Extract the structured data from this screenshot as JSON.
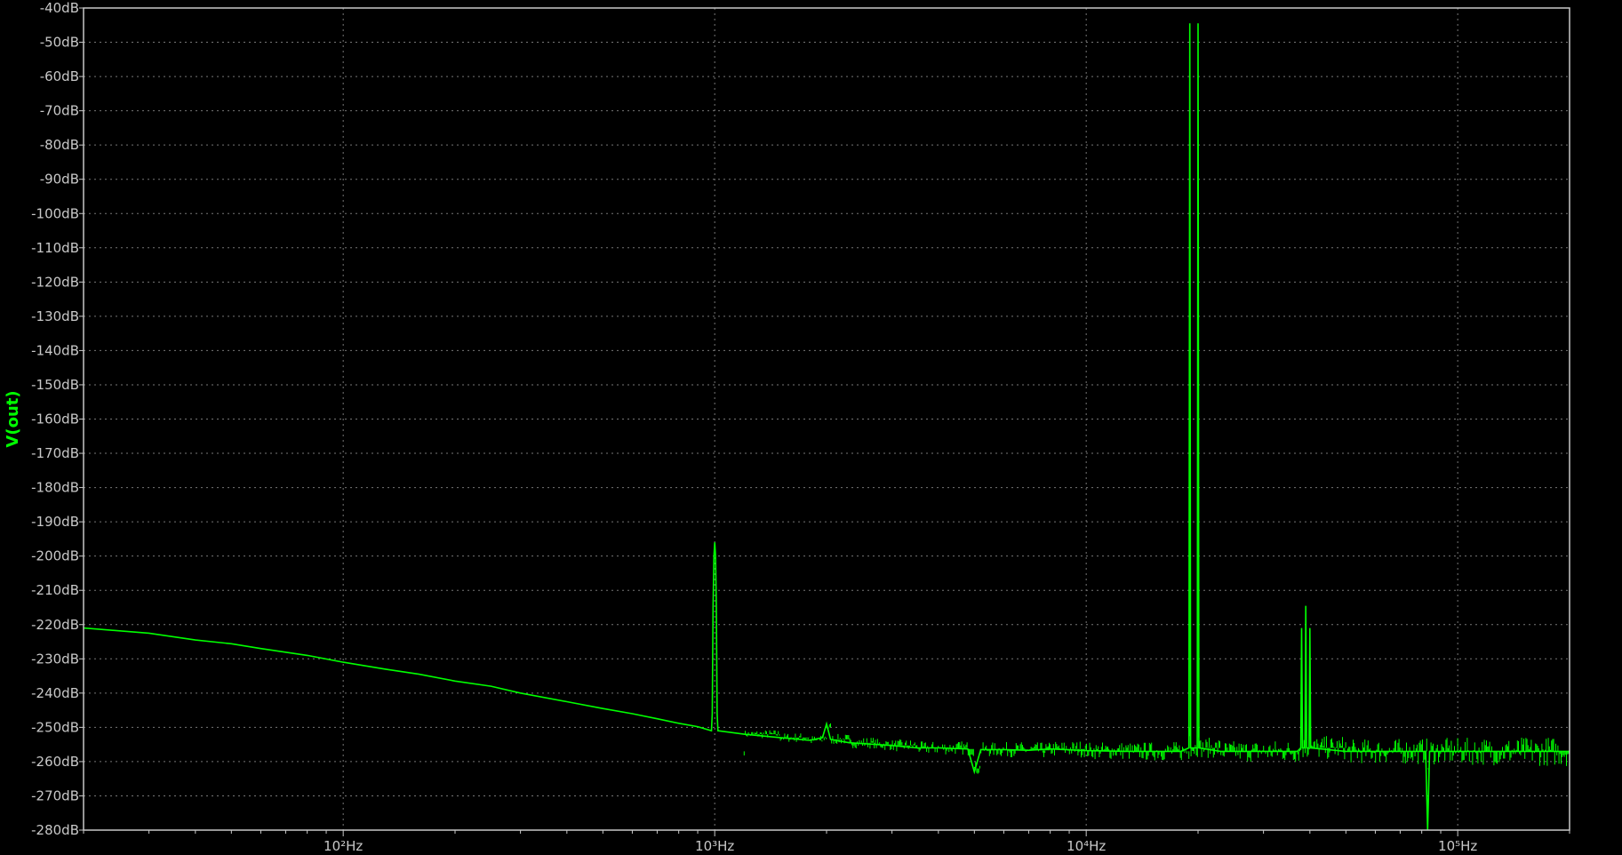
{
  "chart_data": {
    "type": "line",
    "x_scale": "log",
    "xlim": [
      20,
      200000
    ],
    "ylim": [
      -280,
      -40
    ],
    "ylabel": "V(out)",
    "y_ticks": [
      -40,
      -50,
      -60,
      -70,
      -80,
      -90,
      -100,
      -110,
      -120,
      -130,
      -140,
      -150,
      -160,
      -170,
      -180,
      -190,
      -200,
      -210,
      -220,
      -230,
      -240,
      -250,
      -260,
      -270,
      -280
    ],
    "y_tick_labels": [
      "-40dB",
      "-50dB",
      "-60dB",
      "-70dB",
      "-80dB",
      "-90dB",
      "-100dB",
      "-110dB",
      "-120dB",
      "-130dB",
      "-140dB",
      "-150dB",
      "-160dB",
      "-170dB",
      "-180dB",
      "-190dB",
      "-200dB",
      "-210dB",
      "-220dB",
      "-230dB",
      "-240dB",
      "-250dB",
      "-260dB",
      "-270dB",
      "-280dB"
    ],
    "x_major_ticks": [
      100,
      1000,
      10000,
      100000
    ],
    "x_tick_labels": [
      "10²Hz",
      "10³Hz",
      "10⁴Hz",
      "10⁵Hz"
    ],
    "grid": true,
    "colors": {
      "background": "#000000",
      "trace": "#00ff00",
      "grid": "#777777",
      "axis": "#c8c8c8"
    },
    "series": [
      {
        "name": "V(out)",
        "color": "#00ff00",
        "points": [
          [
            20,
            -221
          ],
          [
            30,
            -222.5
          ],
          [
            40,
            -224.5
          ],
          [
            50,
            -225.6
          ],
          [
            60,
            -227
          ],
          [
            80,
            -229
          ],
          [
            100,
            -231
          ],
          [
            130,
            -233
          ],
          [
            160,
            -234.5
          ],
          [
            200,
            -236.5
          ],
          [
            250,
            -238
          ],
          [
            300,
            -240
          ],
          [
            400,
            -242.5
          ],
          [
            500,
            -244.5
          ],
          [
            600,
            -246
          ],
          [
            700,
            -247.5
          ],
          [
            800,
            -248.8
          ],
          [
            900,
            -249.8
          ],
          [
            980,
            -251
          ],
          [
            985,
            -246
          ],
          [
            990,
            -215
          ],
          [
            995,
            -200
          ],
          [
            1000,
            -196
          ],
          [
            1005,
            -200
          ],
          [
            1010,
            -215
          ],
          [
            1015,
            -246
          ],
          [
            1020,
            -251
          ],
          [
            1200,
            -252
          ],
          [
            1500,
            -253
          ],
          [
            1800,
            -253.8
          ],
          [
            1950,
            -253
          ],
          [
            2000,
            -249
          ],
          [
            2050,
            -253.5
          ],
          [
            2300,
            -254.5
          ],
          [
            2700,
            -255
          ],
          [
            3000,
            -255.3
          ],
          [
            3500,
            -256
          ],
          [
            4000,
            -256
          ],
          [
            4800,
            -256.3
          ],
          [
            5000,
            -263
          ],
          [
            5200,
            -256.5
          ],
          [
            6000,
            -256.5
          ],
          [
            7000,
            -256.7
          ],
          [
            8000,
            -256.3
          ],
          [
            10000,
            -256.8
          ],
          [
            13000,
            -257
          ],
          [
            16000,
            -257
          ],
          [
            18000,
            -257
          ],
          [
            18900,
            -256
          ],
          [
            19000,
            -44.5
          ],
          [
            19100,
            -256
          ],
          [
            19900,
            -256
          ],
          [
            20000,
            -44.5
          ],
          [
            20100,
            -256
          ],
          [
            23000,
            -257
          ],
          [
            30000,
            -257
          ],
          [
            37000,
            -257
          ],
          [
            37800,
            -256
          ],
          [
            38000,
            -221
          ],
          [
            38200,
            -256
          ],
          [
            38800,
            -256
          ],
          [
            39000,
            -214.5
          ],
          [
            39200,
            -256
          ],
          [
            39800,
            -256
          ],
          [
            40000,
            -221
          ],
          [
            40200,
            -256
          ],
          [
            50000,
            -257
          ],
          [
            70000,
            -257
          ],
          [
            82000,
            -257
          ],
          [
            83000,
            -280
          ],
          [
            84000,
            -257
          ],
          [
            100000,
            -257
          ],
          [
            150000,
            -257
          ],
          [
            200000,
            -257
          ]
        ]
      }
    ]
  }
}
